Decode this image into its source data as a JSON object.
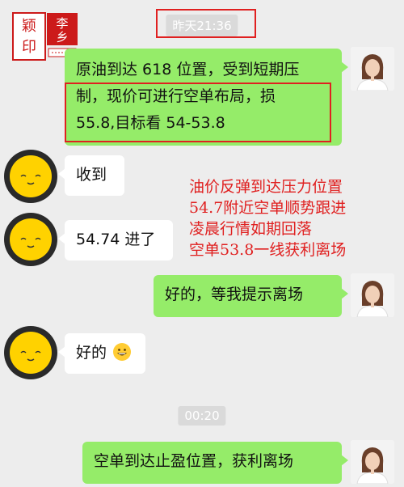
{
  "stamp": {
    "top_chars": "李乡",
    "bottom_chars": "颖印",
    "small_text": "日日日日"
  },
  "timestamps": {
    "first": "昨天21:36",
    "second": "00:20"
  },
  "messages": {
    "m1_line1": "原油到达 618 位置，受到短期压",
    "m1_line2": "制，现价可进行空单布局，损",
    "m1_line3": "55.8,目标看 54-53.8",
    "m2": "收到",
    "m3": "54.74 进了",
    "m4": "好的，等我提示离场",
    "m5": "好的",
    "m6": "空单到达止盈位置，获利离场"
  },
  "overlay": {
    "line1": "油价反弹到达压力位置",
    "line2": "54.7附近空单顺势跟进",
    "line3": "凌晨行情如期回落",
    "line4": "空单53.8一线获利离场"
  },
  "colors": {
    "outgoing_bubble": "#95ec69",
    "incoming_bubble": "#ffffff",
    "highlight": "#e02020",
    "background": "#ededed"
  }
}
